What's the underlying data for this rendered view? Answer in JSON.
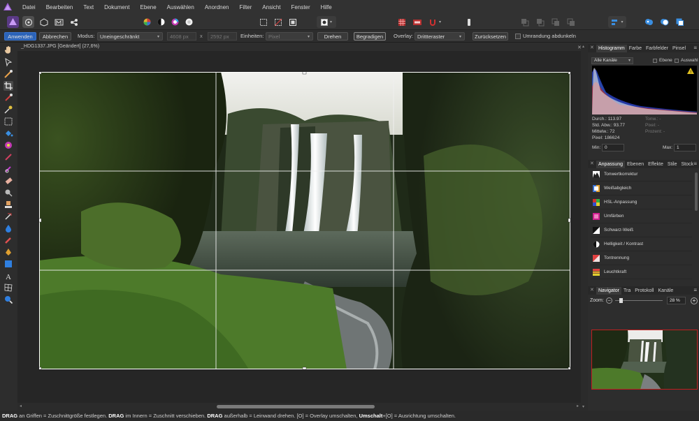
{
  "menu": [
    "Datei",
    "Bearbeiten",
    "Text",
    "Dokument",
    "Ebene",
    "Auswählen",
    "Anordnen",
    "Filter",
    "Ansicht",
    "Fenster",
    "Hilfe"
  ],
  "context": {
    "apply": "Anwenden",
    "cancel": "Abbrechen",
    "mode_label": "Modus:",
    "mode_value": "Uneingeschränkt",
    "width": "4608 px",
    "x": "x",
    "height": "2592 px",
    "units_label": "Einheiten:",
    "units_value": "Pixel",
    "rotate": "Drehen",
    "straighten": "Begradigen",
    "overlay_label": "Overlay:",
    "overlay_value": "Drittteraster",
    "reset": "Zurücksetzen",
    "darken": "Umrandung abdunkeln"
  },
  "document": {
    "tab_title": "_HDG1337.JPG [Geändert] (27,6%)"
  },
  "histogram": {
    "tabs": [
      "Histogramm",
      "Farbe",
      "Farbfelder",
      "Pinsel"
    ],
    "channel": "Alle Kanäle",
    "layer": "Ebene",
    "selection": "Auswahl",
    "mean": "Durch.: 113.97",
    "stddev": "Std. Abw.: 93.77",
    "median": "Mittelw.: 72",
    "pixels": "Pixel: 186624",
    "tonal": "Tonw.: -",
    "pixel": "Pixel: -",
    "percent": "Prozent: -",
    "min_label": "Min:",
    "min_value": "0",
    "max_label": "Max:",
    "max_value": "1"
  },
  "adjustments": {
    "tabs": [
      "Anpassung",
      "Ebenen",
      "Effekte",
      "Stile",
      "Stock"
    ],
    "items": [
      "Tonwertkorrektur",
      "Weißabgleich",
      "HSL-Anpassung",
      "Umfärben",
      "Schwarz-Weiß",
      "Helligkeit / Kontrast",
      "Tontrennung",
      "Leuchtkraft"
    ]
  },
  "navigator": {
    "tabs": [
      "Navigator",
      "Tra",
      "Protokoll",
      "Kanäle"
    ],
    "zoom_label": "Zoom:",
    "zoom_value": "28 %",
    "minus": "−",
    "plus": "+"
  },
  "status": {
    "p1_bold": "DRAG",
    "p1": " an Griffen = Zuschnittgröße festlegen. ",
    "p2_bold": "DRAG",
    "p2": " im Innern = Zuschnitt verschieben. ",
    "p3_bold": "DRAG",
    "p3": " außerhalb = Leinwand drehen. [O] = Overlay umschalten, ",
    "p4_bold": "Umschalt",
    "p4": "+[O] = Ausrichtung umschalten."
  },
  "colors": {
    "accent": "#2b63b8",
    "app_purple": "#8a55c9"
  }
}
